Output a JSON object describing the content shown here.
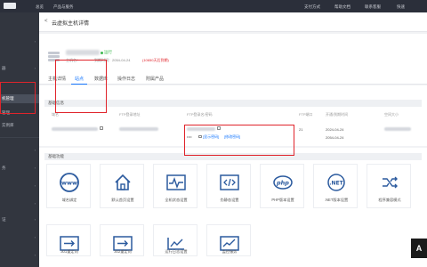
{
  "topbar": {
    "items": [
      "总览",
      "产品与服务",
      "支付方式",
      "帮助文档",
      "联系客服",
      "快速"
    ]
  },
  "sidebar": {
    "items": [
      {
        "label": "",
        "active": false
      },
      {
        "label": "器",
        "active": false
      },
      {
        "label": "机管理",
        "active": true
      },
      {
        "label": "管理",
        "active": false
      },
      {
        "label": "实例库",
        "active": false
      },
      {
        "label": "",
        "active": false
      },
      {
        "label": "务",
        "active": false
      },
      {
        "label": "",
        "active": false
      },
      {
        "label": "",
        "active": false
      },
      {
        "label": "证",
        "active": false
      },
      {
        "label": "",
        "active": false
      },
      {
        "label": "",
        "active": false
      }
    ]
  },
  "header": {
    "back": "<",
    "title": "云虚拟主机详情"
  },
  "server": {
    "status": "运行",
    "meta": [
      {
        "text": "主机名："
      },
      {
        "text": "到期时间：2054-04-24"
      },
      {
        "text": "(10650天后到期)",
        "red": true
      }
    ]
  },
  "tabs": [
    "主机详情",
    "站点",
    "数据库",
    "操作日志",
    "附属产品"
  ],
  "basic_info": {
    "title": "基础信息",
    "columns": [
      "域名",
      "FTP登录地址",
      "FTP登录名/密码",
      "FTP端口",
      "开通/到期时间",
      "空间大小"
    ],
    "ftp_password_mask": "••••",
    "show_password": "[显示密码]",
    "change_password": "[修改密码]",
    "ftp_port": "21",
    "open_date": "2024-04-24",
    "expire_date": "2054-04-24"
  },
  "features": {
    "title": "基础功能",
    "tiles": [
      {
        "label": "域名绑定",
        "icon": "www-icon"
      },
      {
        "label": "默认首页设置",
        "icon": "home-icon"
      },
      {
        "label": "全机状态设置",
        "icon": "pulse-icon"
      },
      {
        "label": "伪静态设置",
        "icon": "code-icon"
      },
      {
        "label": "PHP版本设置",
        "icon": "php-icon"
      },
      {
        "label": ".NET版本设置",
        "icon": "dotnet-icon"
      },
      {
        "label": "程序兼容模式",
        "icon": "shuffle-icon"
      },
      {
        "label": "301重定向",
        "icon": "redirect-icon"
      },
      {
        "label": "302重定向",
        "icon": "redirect-icon"
      },
      {
        "label": "运行日志设置",
        "icon": "chart-icon"
      },
      {
        "label": "监控服务",
        "icon": "monitor-icon"
      }
    ]
  },
  "accent_color": "#1677ff",
  "annotation_color": "#e0242b"
}
